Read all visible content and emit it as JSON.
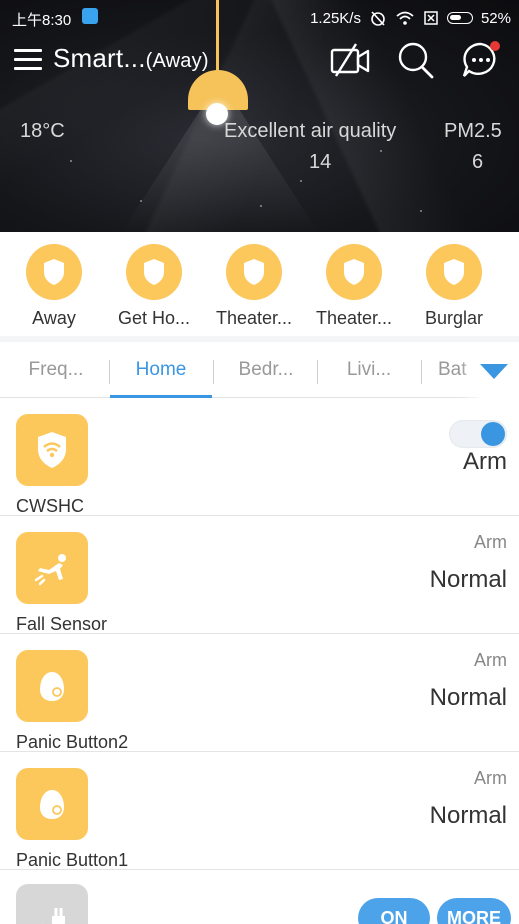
{
  "status_bar": {
    "time": "上午8:30",
    "speed": "1.25K/s",
    "battery": "52%"
  },
  "app_bar": {
    "title": "Smart...",
    "mode": "(Away)"
  },
  "weather": {
    "temperature": "18°C",
    "air_quality_label": "Excellent air quality",
    "air_quality_value": "14",
    "pm_label": "PM2.5",
    "pm_value": "6"
  },
  "scenes": [
    {
      "label": "Away"
    },
    {
      "label": "Get Ho..."
    },
    {
      "label": "Theater..."
    },
    {
      "label": "Theater..."
    },
    {
      "label": "Burglar"
    }
  ],
  "tabs": [
    {
      "label": "Freq..."
    },
    {
      "label": "Home",
      "active": true
    },
    {
      "label": "Bedr..."
    },
    {
      "label": "Livi..."
    },
    {
      "label": "Bat"
    }
  ],
  "devices": [
    {
      "name": "CWSHC",
      "status": "Arm",
      "toggle_on": true,
      "icon": "wifi-shield-icon"
    },
    {
      "name": "Fall Sensor",
      "mode": "Arm",
      "status": "Normal",
      "icon": "fall-sensor-icon"
    },
    {
      "name": "Panic Button2",
      "mode": "Arm",
      "status": "Normal",
      "icon": "panic-button-icon"
    },
    {
      "name": "Panic Button1",
      "mode": "Arm",
      "status": "Normal",
      "icon": "panic-button-icon"
    }
  ],
  "partial_device": {
    "on_label": "ON",
    "more_label": "MORE",
    "icon": "plug-icon"
  },
  "colors": {
    "accent": "#3b96e2",
    "icon_yellow": "#fcc75b",
    "header_bg": "#15161a"
  }
}
